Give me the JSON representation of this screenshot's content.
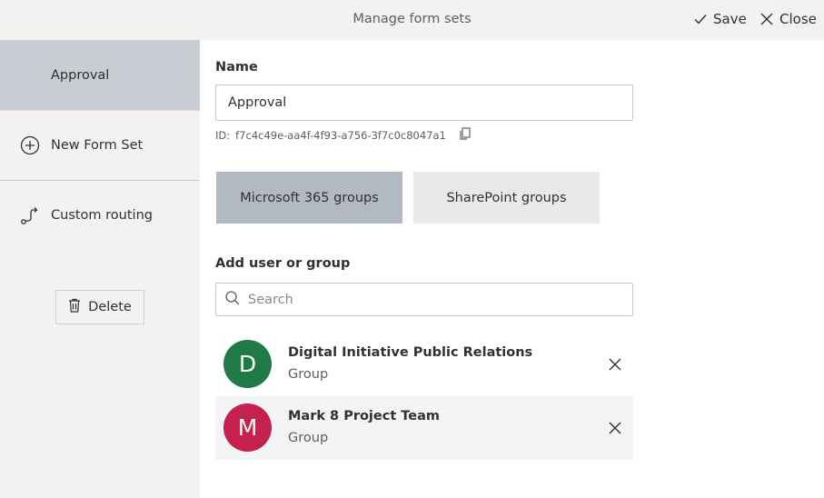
{
  "header": {
    "title": "Manage form sets",
    "save_label": "Save",
    "close_label": "Close"
  },
  "sidebar": {
    "items": [
      {
        "label": "Approval",
        "active": true
      },
      {
        "label": "New Form Set",
        "icon": "add-circle-icon"
      },
      {
        "label": "Custom routing",
        "icon": "route-icon"
      }
    ],
    "delete_label": "Delete"
  },
  "form": {
    "name_label": "Name",
    "name_value": "Approval",
    "id_prefix": "ID:",
    "id_value": "f7c4c49e-aa4f-4f93-a756-3f7c0c8047a1",
    "tabs": [
      {
        "label": "Microsoft 365 groups",
        "selected": true
      },
      {
        "label": "SharePoint groups",
        "selected": false
      }
    ],
    "add_label": "Add user or group",
    "search_placeholder": "Search"
  },
  "members": [
    {
      "initial": "D",
      "name": "Digital Initiative Public Relations",
      "type": "Group",
      "color": "#1f7a45"
    },
    {
      "initial": "M",
      "name": "Mark 8 Project Team",
      "type": "Group",
      "color": "#c4214d"
    }
  ],
  "colors": {
    "sidebar_bg": "#f3f2f1",
    "active_item": "#c8ccd3",
    "selected_tab": "#b3b9c2",
    "unselected_tab": "#e9e9ea"
  }
}
